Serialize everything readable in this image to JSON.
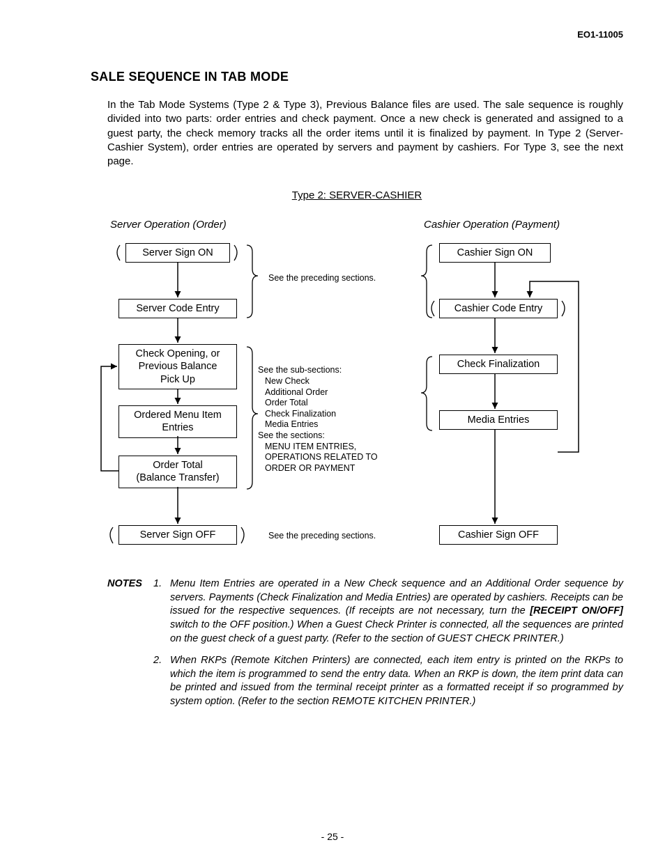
{
  "doc_id": "EO1-11005",
  "heading": "SALE SEQUENCE IN TAB MODE",
  "intro": "In the Tab Mode Systems (Type 2 & Type 3), Previous Balance files are used. The sale sequence is roughly divided into two parts: order entries and check payment. Once a new check is generated and assigned to a guest party, the check memory tracks all the order items until it is finalized by payment. In Type 2 (Server-Cashier System), order entries are operated by servers and payment by cashiers. For Type 3, see the next page.",
  "type_label": "Type 2: SERVER-CASHIER",
  "left_header": "Server Operation (Order)",
  "right_header": "Cashier Operation (Payment)",
  "left_boxes": {
    "b1": "Server Sign ON",
    "b2": "Server Code Entry",
    "b3": "Check Opening, or\nPrevious Balance\nPick Up",
    "b4": "Ordered Menu Item\nEntries",
    "b5": "Order Total\n(Balance Transfer)",
    "b6": "Server Sign OFF"
  },
  "right_boxes": {
    "b1": "Cashier Sign ON",
    "b2": "Cashier Code Entry",
    "b3": "Check Finalization",
    "b4": "Media Entries",
    "b5": "Cashier Sign OFF"
  },
  "mid_notes": {
    "n1": "See the preceding sections.",
    "n2_header": "See the sub-sections:",
    "n2_items": "New Check\nAdditional Order\nOrder Total\nCheck Finalization\nMedia Entries",
    "n2_header2": "See the sections:",
    "n2_items2": "MENU ITEM ENTRIES,\nOPERATIONS RELATED TO\nORDER OR PAYMENT",
    "n3": "See the preceding sections."
  },
  "notes_label": "NOTES",
  "notes": {
    "n1_num": "1.",
    "n1_a": "Menu Item Entries are operated in a New Check sequence and an Additional Order sequence by servers. Payments (Check Finalization and Media Entries) are operated by cashiers. Receipts can be issued for the respective sequences. (If receipts are not necessary, turn the ",
    "n1_bold": "[RECEIPT ON/OFF]",
    "n1_b": " switch to the OFF position.) When a Guest Check Printer is connected, all the sequences are printed on the guest check of a guest party. (Refer to the section of GUEST CHECK PRINTER.)",
    "n2_num": "2.",
    "n2": "When RKPs (Remote Kitchen Printers) are connected, each item entry is printed on the RKPs to which the item is programmed to send the entry data. When an RKP is down, the item print data can be printed and issued from the terminal receipt printer as a formatted receipt if so programmed by system option. (Refer to the section REMOTE KITCHEN PRINTER.)"
  },
  "page_number": "- 25 -"
}
